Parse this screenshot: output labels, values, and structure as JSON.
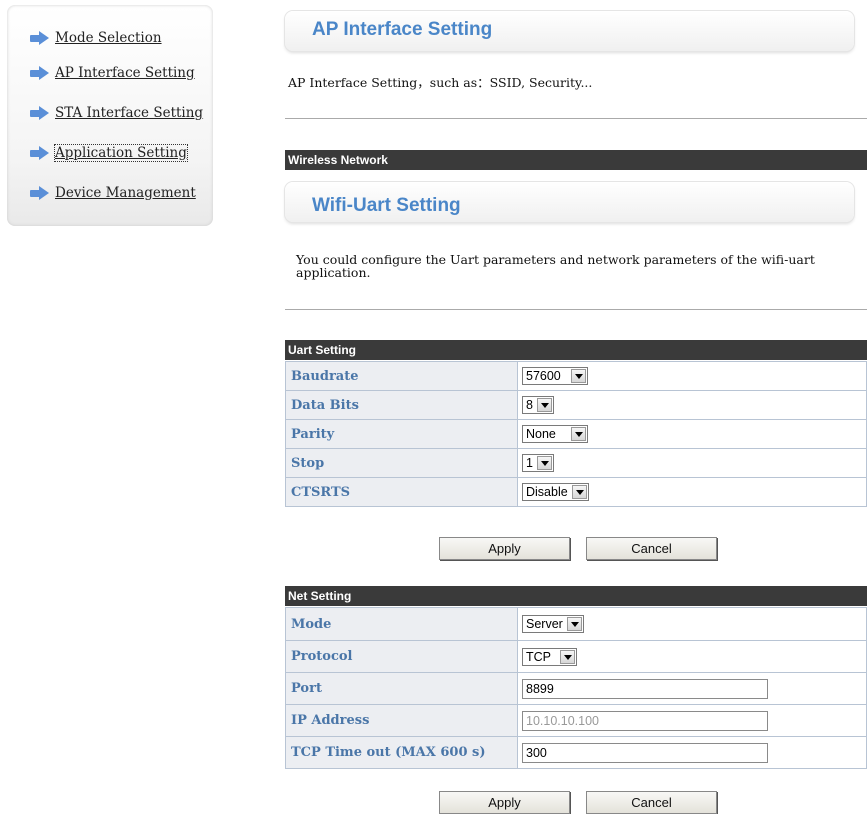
{
  "sidebar": {
    "items": [
      {
        "label": "Mode Selection",
        "icon": "arrow-right-icon"
      },
      {
        "label": "AP Interface Setting",
        "icon": "arrow-right-icon"
      },
      {
        "label": "STA Interface Setting",
        "icon": "arrow-right-icon"
      },
      {
        "label": "Application Setting",
        "icon": "arrow-right-icon"
      },
      {
        "label": "Device Management",
        "icon": "arrow-right-icon"
      }
    ]
  },
  "ap_section": {
    "title": "AP Interface Setting",
    "description": "AP Interface Setting，such as：SSID, Security..."
  },
  "wireless_bar": "Wireless Network",
  "uart_section": {
    "title": "Wifi-Uart Setting",
    "description_line1": "You could configure the Uart parameters and network parameters of the wifi-uart",
    "description_line2": "application."
  },
  "uart_setting": {
    "header": "Uart Setting",
    "rows": [
      {
        "label": "Baudrate",
        "value": "57600"
      },
      {
        "label": "Data Bits",
        "value": "8"
      },
      {
        "label": "Parity",
        "value": "None"
      },
      {
        "label": "Stop",
        "value": "1"
      },
      {
        "label": "CTSRTS",
        "value": "Disable"
      }
    ],
    "apply_label": "Apply",
    "cancel_label": "Cancel"
  },
  "net_setting": {
    "header": "Net Setting",
    "mode": {
      "label": "Mode",
      "value": "Server"
    },
    "protocol": {
      "label": "Protocol",
      "value": "TCP"
    },
    "port": {
      "label": "Port",
      "value": "8899"
    },
    "ip_address": {
      "label": "IP Address",
      "value": "10.10.10.100"
    },
    "timeout": {
      "label": "TCP Time out (MAX 600 s)",
      "value": "300"
    },
    "apply_label": "Apply",
    "cancel_label": "Cancel"
  },
  "colors": {
    "accent": "#4a86c8",
    "label_text": "#4a76a8",
    "bar": "#3a3a3a"
  }
}
